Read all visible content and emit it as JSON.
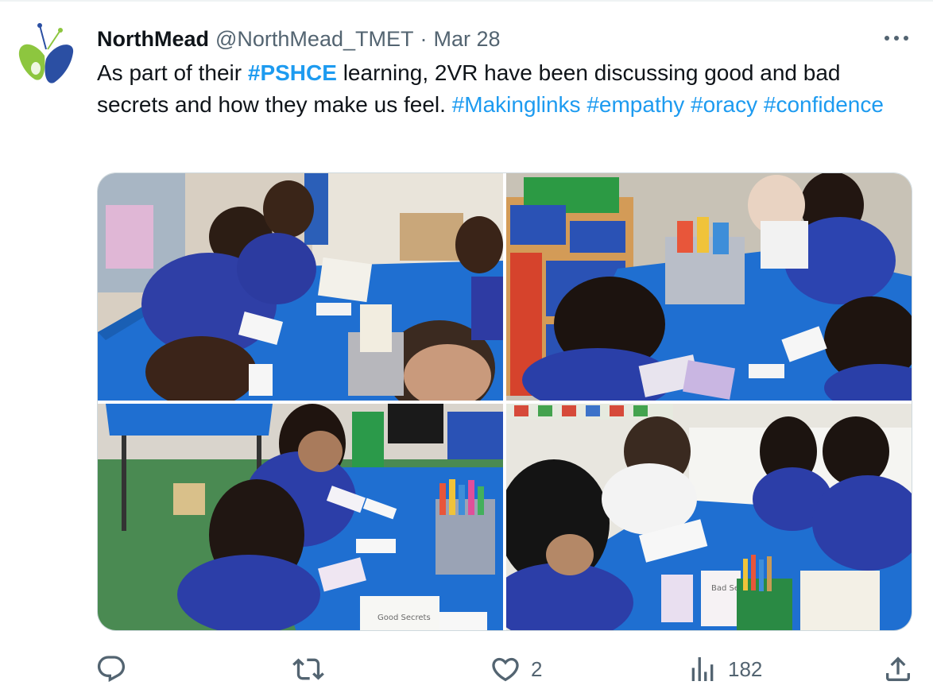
{
  "tweet": {
    "author_name": "NorthMead",
    "handle": "@NorthMead_TMET",
    "separator": "·",
    "date": "Mar 28",
    "text_segments": [
      {
        "text": "As part of their ",
        "type": "plain"
      },
      {
        "text": "#PSHCE",
        "type": "hashtag-bold"
      },
      {
        "text": " learning, 2VR have been discussing good and bad secrets and how they make us feel. ",
        "type": "plain"
      },
      {
        "text": "#Makinglinks",
        "type": "hashtag"
      },
      {
        "text": " ",
        "type": "plain"
      },
      {
        "text": "#empathy",
        "type": "hashtag"
      },
      {
        "text": " ",
        "type": "plain"
      },
      {
        "text": "#oracy",
        "type": "hashtag"
      },
      {
        "text": " ",
        "type": "plain"
      },
      {
        "text": "#confidence",
        "type": "hashtag"
      }
    ]
  },
  "media": {
    "photos": [
      {
        "name": "classroom-photo-1",
        "label": ""
      },
      {
        "name": "classroom-photo-2",
        "label": ""
      },
      {
        "name": "classroom-photo-3",
        "label": "Good Secrets"
      },
      {
        "name": "classroom-photo-4",
        "label": "Bad Se"
      }
    ]
  },
  "actions": {
    "reply_count": "",
    "repost_count": "",
    "like_count": "2",
    "views_count": "182"
  },
  "colors": {
    "accent": "#1d9bf0",
    "secondary_text": "#536471",
    "primary_text": "#0f1419",
    "logo_green": "#8dc63f",
    "logo_blue": "#2b4fa3"
  },
  "icons": {
    "avatar": "butterfly-logo-icon",
    "more": "more-horizontal-icon",
    "reply": "reply-icon",
    "repost": "repost-icon",
    "like": "heart-icon",
    "views": "views-icon",
    "share": "share-icon"
  }
}
